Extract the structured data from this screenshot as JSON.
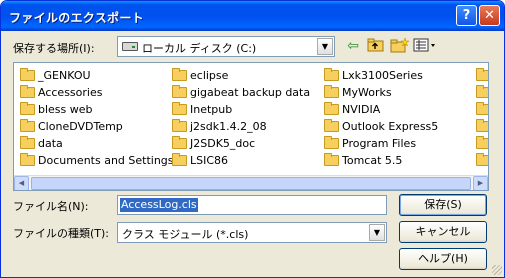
{
  "window": {
    "title": "ファイルのエクスポート",
    "help_glyph": "?",
    "close_glyph": "✕"
  },
  "location": {
    "label": "保存する場所(I):",
    "value": "ローカル ディスク (C:)",
    "arrow": "▼"
  },
  "toolbar": {
    "back_icon": "back-arrow-icon",
    "up_icon": "up-folder-icon",
    "new_folder_icon": "new-folder-icon",
    "views_icon": "views-menu-icon"
  },
  "files": {
    "col1": [
      "_GENKOU",
      "Accessories",
      "bless web",
      "CloneDVDTemp",
      "data",
      "Documents and Settings"
    ],
    "col2": [
      "eclipse",
      "gigabeat backup data",
      "Inetpub",
      "j2sdk1.4.2_08",
      "J2SDK5_doc",
      "LSIC86"
    ],
    "col3": [
      "Lxk3100Series",
      "MyWorks",
      "NVIDIA",
      "Outlook Express5",
      "Program Files",
      "Tomcat 5.5"
    ]
  },
  "scrollbar": {
    "left": "◀",
    "right": "▶"
  },
  "filename": {
    "label": "ファイル名(N):",
    "value": "AccessLog.cls"
  },
  "filetype": {
    "label": "ファイルの種類(T):",
    "value": "クラス モジュール (*.cls)",
    "arrow": "▼"
  },
  "buttons": {
    "save": "保存(S)",
    "cancel": "キャンセル",
    "help": "ヘルプ(H)"
  }
}
